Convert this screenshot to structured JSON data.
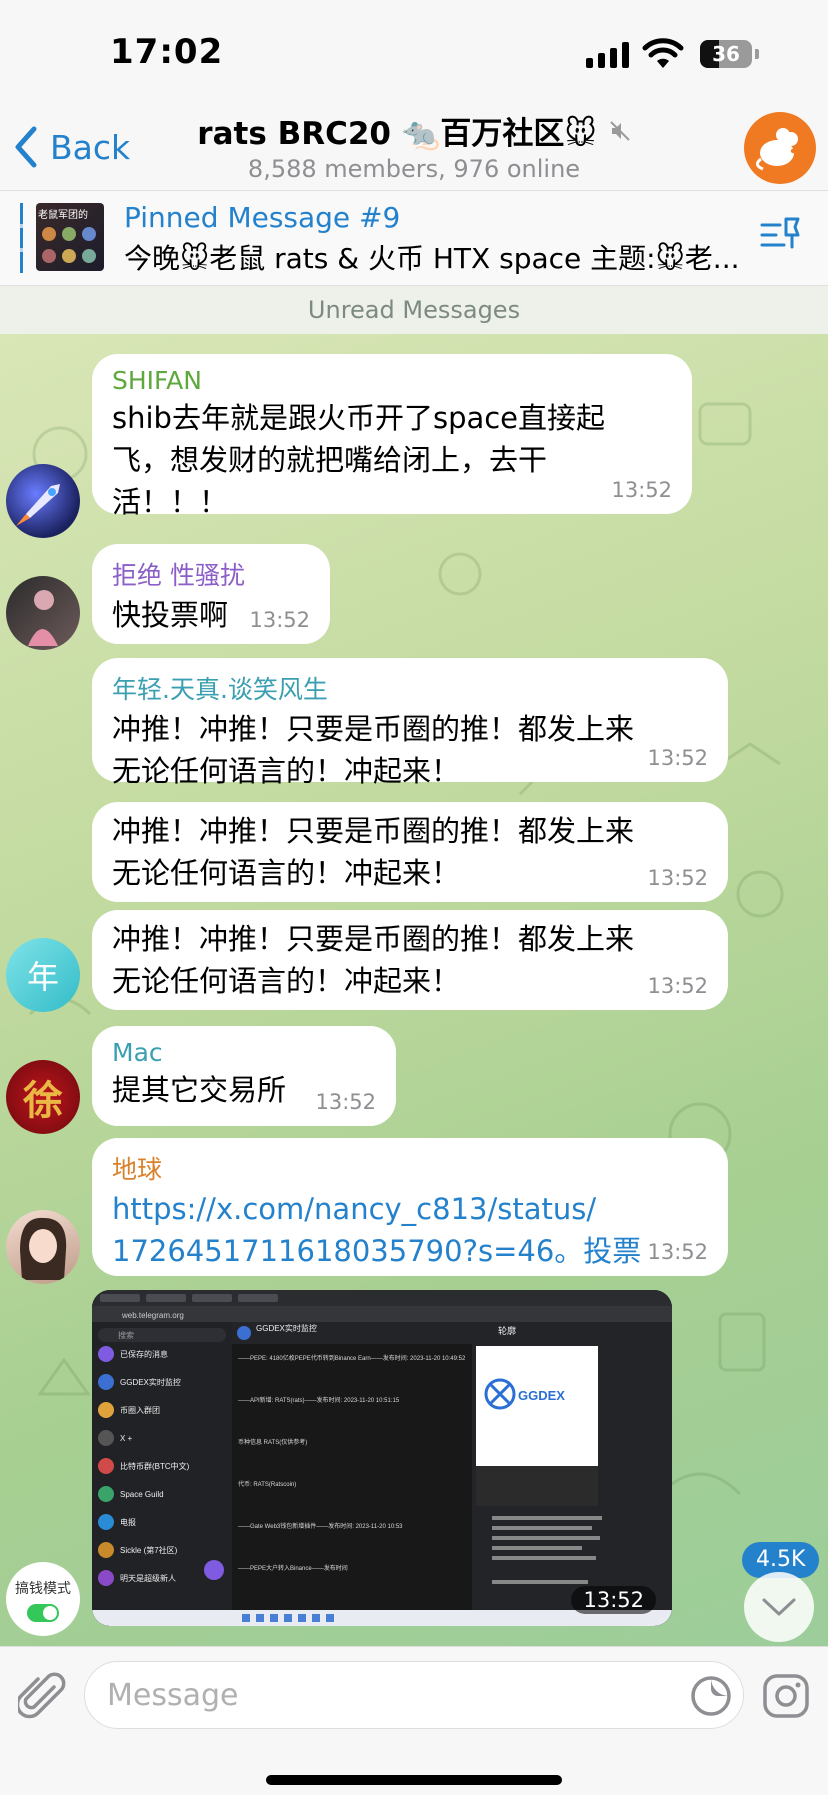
{
  "status_bar": {
    "time": "17:02",
    "battery": "36",
    "battery_level": 0.36
  },
  "header": {
    "back_label": "Back",
    "title": "rats BRC20 🐀百万社区🐭",
    "subtitle": "8,588 members, 976 online"
  },
  "pinned": {
    "thumb_text": "老鼠军团的",
    "label": "Pinned Message #9",
    "text": "今晚🐭老鼠 rats & 火币 HTX space 主题:🐭老..."
  },
  "unread_divider": "Unread Messages",
  "messages": [
    {
      "sender": "SHIFAN",
      "sender_color": "#5fa83d",
      "lines": [
        "shib去年就是跟火币开了space直接起",
        "飞，想发财的就把嘴给闭上，去干",
        "活！！！"
      ],
      "time": "13:52"
    },
    {
      "sender": "拒绝 性骚扰",
      "sender_color": "#8b5fc7",
      "lines": [
        "快投票啊"
      ],
      "time": "13:52"
    },
    {
      "sender": "年轻.天真.谈笑风生",
      "sender_color": "#3a9fb0",
      "lines": [
        "冲推！冲推！只要是币圈的推！都发上来",
        "无论任何语言的！冲起来！"
      ],
      "time": "13:52"
    },
    {
      "lines": [
        "冲推！冲推！只要是币圈的推！都发上来",
        "无论任何语言的！冲起来！"
      ],
      "time": "13:52"
    },
    {
      "lines": [
        "冲推！冲推！只要是币圈的推！都发上来",
        "无论任何语言的！冲起来！"
      ],
      "time": "13:52"
    },
    {
      "sender": "Mac",
      "sender_color": "#3a9fb0",
      "lines": [
        "提其它交易所"
      ],
      "time": "13:52"
    },
    {
      "sender": "地球",
      "sender_color": "#d9822b",
      "lines": [
        "https://x.com/nancy_c813/status/",
        "1726451711618035790?s=46。投票"
      ],
      "time": "13:52"
    },
    {
      "time": "13:52"
    }
  ],
  "avatar_text_nian": "年",
  "avatar_text_mac": "徐",
  "screenshot_window": {
    "channel_title": "GGDEX实时监控",
    "right_panel_title": "轮廓",
    "brand": "GGDEX",
    "url": "web.telegram.org",
    "search": "搜索",
    "chats": [
      "已保存的消息",
      "GGDEX实时监控",
      "币圈入群团",
      "X +",
      "比特币群(BTC中文)",
      "Space Guild",
      "电报",
      "Sickle (第7社区)",
      "明天是超级新人"
    ],
    "lines": [
      "——PEPE: 4180亿枚PEPE代币转到Binance Earn——发布时间: 2023-11-20 10:49:52",
      "——API新增: RATS(rats)——发布时间: 2023-11-20 10:51:15",
      "币种信息 RATS(仅供参考)",
      "代币: RATS(Ratscoin)",
      "——Gate Web3钱包新增插件——发布时间: 2023-11-20 10:53",
      "——PEPE大户转入Binance——发布时间"
    ]
  },
  "unread_count": "4.5K",
  "mode_widget": {
    "label": "搞钱模式"
  },
  "input": {
    "placeholder": "Message"
  },
  "colors": {
    "accent": "#2481cc",
    "time_gray": "#8e8e93",
    "online_green": "#34c759"
  },
  "icons": [
    "back-chevron-icon",
    "mute-icon",
    "pinned-list-icon",
    "attach-icon",
    "sticker-icon",
    "camera-icon",
    "chevron-down-icon"
  ]
}
